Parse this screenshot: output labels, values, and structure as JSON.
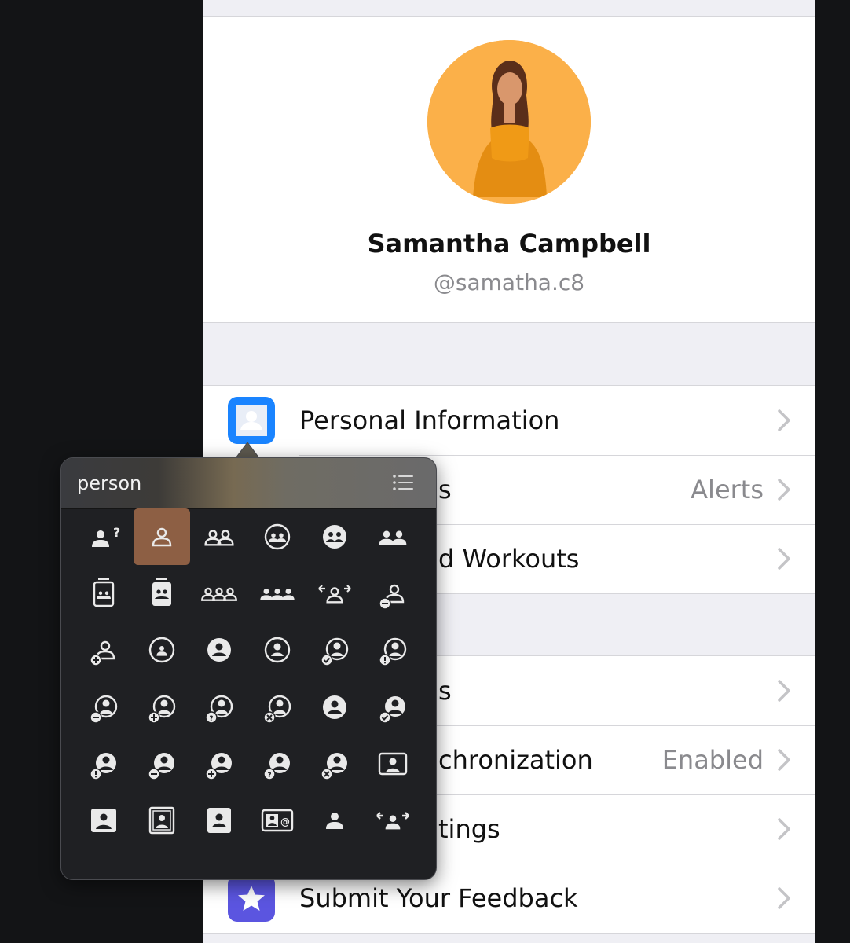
{
  "profile": {
    "name": "Samantha Campbell",
    "handle": "@samatha.c8",
    "avatar_bg": "#fbb049"
  },
  "settings": {
    "group1": [
      {
        "label": "Personal Information",
        "value": "",
        "icon": "person-icon",
        "icon_color": "#1a84ff"
      },
      {
        "label": "s",
        "value": "Alerts"
      },
      {
        "label": "d Workouts",
        "value": ""
      }
    ],
    "group2": [
      {
        "label": "s",
        "value": ""
      },
      {
        "label": "chronization",
        "value": "Enabled"
      },
      {
        "label": "tings",
        "value": ""
      },
      {
        "label": "Submit Your Feedback",
        "value": "",
        "icon": "star-icon",
        "icon_color": "#5b55e0"
      }
    ]
  },
  "symbol_picker": {
    "search_text": "person",
    "selected_index": 1,
    "selected_color": "#8d5f44",
    "symbols": [
      "person-question-icon",
      "person-icon",
      "person-2-icon",
      "person-2-circle-icon",
      "person-2-circle-fill-icon",
      "person-2-fill-icon",
      "person-2-wave-icon",
      "person-2-wave-fill-icon",
      "person-3-icon",
      "person-3-fill-icon",
      "person-arrows-icon",
      "person-minus-icon",
      "person-plus-icon",
      "person-circle-icon",
      "person-circle-fill-icon",
      "person-crop-circle-icon",
      "person-crop-circle-checkmark-icon",
      "person-crop-circle-exclamation-icon",
      "person-crop-circle-minus-icon",
      "person-crop-circle-plus-icon",
      "person-crop-circle-question-icon",
      "person-crop-circle-xmark-icon",
      "person-crop-circle-fill-icon",
      "person-crop-circle-fill-checkmark-icon",
      "person-crop-circle-fill-exclamation-icon",
      "person-crop-circle-fill-minus-icon",
      "person-crop-circle-fill-plus-icon",
      "person-crop-circle-fill-question-icon",
      "person-crop-circle-fill-xmark-icon",
      "person-crop-rectangle-icon",
      "person-crop-square-fill-icon",
      "person-crop-artframe-icon",
      "person-badge-fill-icon",
      "person-text-rectangle-icon",
      "person-fill-icon",
      "person-fill-arrows-icon"
    ]
  }
}
